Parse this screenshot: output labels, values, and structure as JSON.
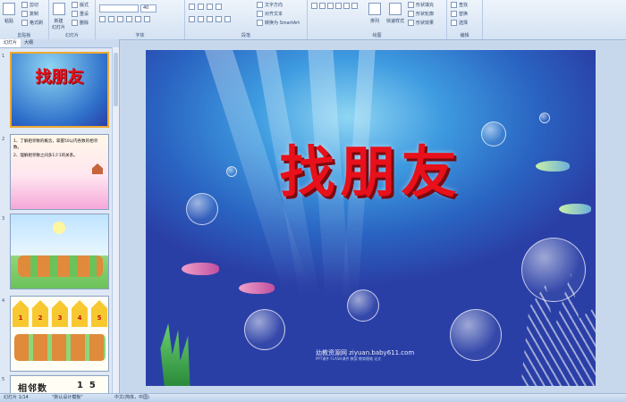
{
  "ribbon": {
    "groups": {
      "clipboard": "剪贴板",
      "slides": "幻灯片",
      "font": "字体",
      "paragraph": "段落",
      "drawing": "绘图",
      "editing": "编辑"
    },
    "paste": "粘贴",
    "cut": "剪切",
    "copy": "复制",
    "format_painter": "格式刷",
    "new_slide": "新建\n幻灯片",
    "layout": "版式",
    "reset": "重设",
    "delete": "删除",
    "font_size": "40",
    "text_direction": "文字方向",
    "align_text": "对齐文本",
    "smartart": "转换为 SmartArt",
    "arrange": "排列",
    "quick_styles": "快速样式",
    "shape_fill": "形状填充",
    "shape_outline": "形状轮廓",
    "shape_effects": "形状效果",
    "find": "查找",
    "replace": "替换",
    "select": "选择"
  },
  "panel": {
    "tab_slides": "幻灯片",
    "tab_outline": "大纲",
    "thumb1_title": "找朋友",
    "thumb2_line1": "1、了解相邻数的概念，掌握50以内各数的相邻数。",
    "thumb2_line2": "2、理解相邻数之间多1少1的关系。",
    "thumb4_numbers": [
      "1",
      "2",
      "3",
      "4",
      "5"
    ],
    "thumb5_text": "相邻数",
    "thumb5_nums": "1  5",
    "slide_numbers": [
      "1",
      "2",
      "3",
      "4",
      "5"
    ]
  },
  "slide": {
    "title": "找朋友",
    "watermark": "幼教资源网 ziyuan.baby611.com",
    "watermark_sub": "PPT课件 FLASH课件 教案 教育随笔 论文"
  },
  "status": {
    "slide_of": "幻灯片 1/14",
    "theme": "\"默认设计模板\"",
    "language": "中文(简体，中国)"
  },
  "colors": {
    "title_red": "#e8101a",
    "selection": "#f0a830",
    "ribbon_bg": "#d4e2f3"
  }
}
